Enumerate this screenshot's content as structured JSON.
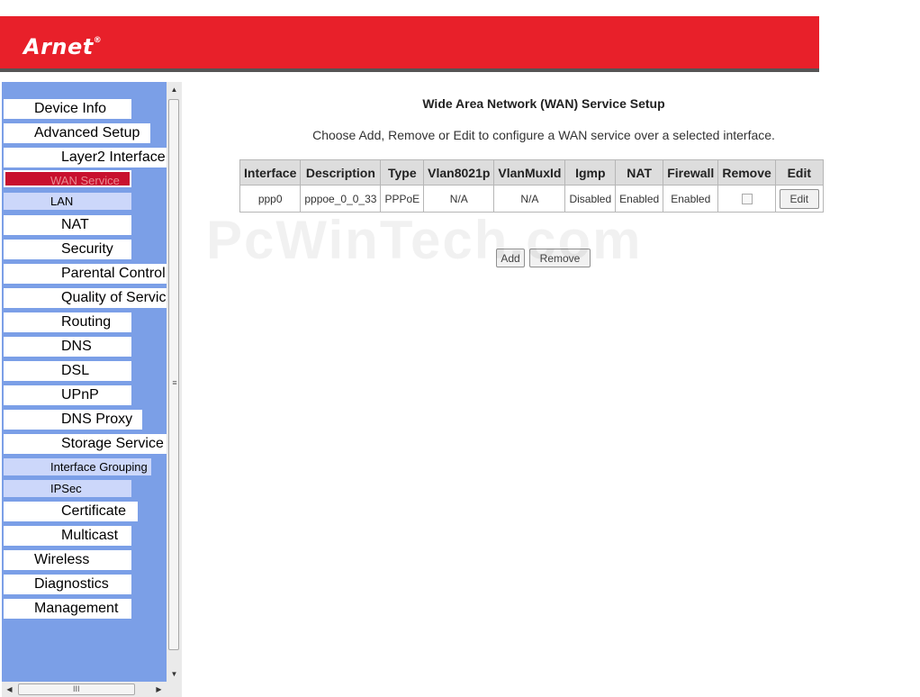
{
  "header": {
    "logo": "Arnet",
    "logo_mark": "®",
    "bg_color": "#e8202a"
  },
  "sidebar": {
    "bg_color": "#7b9fe7",
    "items": [
      {
        "label": "Device Info"
      },
      {
        "label": "Advanced Setup"
      },
      {
        "label": "Layer2 Interface"
      },
      {
        "label": "WAN Service"
      },
      {
        "label": "LAN"
      },
      {
        "label": "NAT"
      },
      {
        "label": "Security"
      },
      {
        "label": "Parental Control"
      },
      {
        "label": "Quality of Service"
      },
      {
        "label": "Routing"
      },
      {
        "label": "DNS"
      },
      {
        "label": "DSL"
      },
      {
        "label": "UPnP"
      },
      {
        "label": "DNS Proxy"
      },
      {
        "label": "Storage Service"
      },
      {
        "label": "Interface Grouping"
      },
      {
        "label": "IPSec"
      },
      {
        "label": "Certificate"
      },
      {
        "label": "Multicast"
      },
      {
        "label": "Wireless"
      },
      {
        "label": "Diagnostics"
      },
      {
        "label": "Management"
      }
    ],
    "active_item": "WAN Service"
  },
  "scrollbars": {
    "up": "▲",
    "down": "▼",
    "left": "◀",
    "right": "▶",
    "grip_v": "≡",
    "grip_h": "III"
  },
  "main": {
    "title": "Wide Area Network (WAN) Service Setup",
    "description": "Choose Add, Remove or Edit to configure a WAN service over a selected interface.",
    "table": {
      "headers": [
        "Interface",
        "Description",
        "Type",
        "Vlan8021p",
        "VlanMuxId",
        "Igmp",
        "NAT",
        "Firewall",
        "Remove",
        "Edit"
      ],
      "rows": [
        {
          "interface": "ppp0",
          "description": "pppoe_0_0_33",
          "type": "PPPoE",
          "vlan8021p": "N/A",
          "vlanmuxid": "N/A",
          "igmp": "Disabled",
          "nat": "Enabled",
          "firewall": "Enabled",
          "remove_checked": false,
          "edit_label": "Edit"
        }
      ]
    },
    "add_label": "Add",
    "remove_label": "Remove"
  },
  "watermark": "PcWinTech.com"
}
